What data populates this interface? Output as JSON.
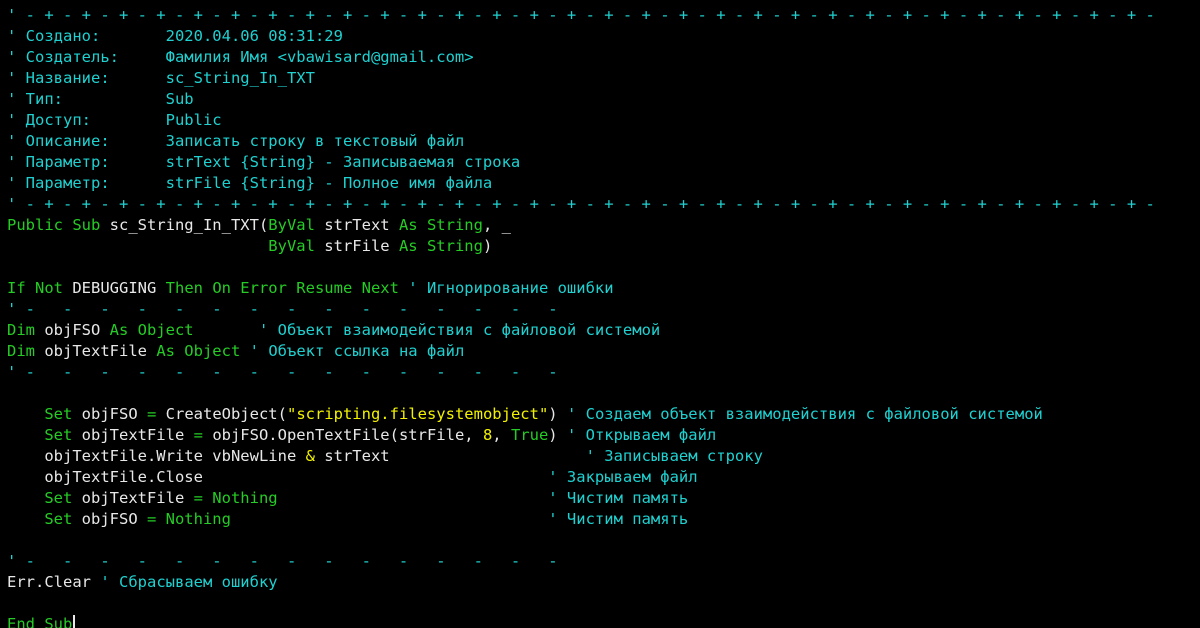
{
  "colors": {
    "background": "#000000",
    "comment": "#1fd1d1",
    "keyword": "#25cc25",
    "text": "#e8e8e8",
    "string": "#f2f200"
  },
  "lines": [
    [
      {
        "t": "' - + - + - + - + - + - + - + - + - + - + - + - + - + - + - + - + - + - + - + - + - + - + - + - + - + - + - + - + - + - + -",
        "c": "c"
      }
    ],
    [
      {
        "t": "' Создано:       2020.04.06 08:31:29",
        "c": "c"
      }
    ],
    [
      {
        "t": "' Создатель:     Фамилия Имя <vbawisard@gmail.com>",
        "c": "c"
      }
    ],
    [
      {
        "t": "' Название:      sc_String_In_TXT",
        "c": "c"
      }
    ],
    [
      {
        "t": "' Тип:           Sub",
        "c": "c"
      }
    ],
    [
      {
        "t": "' Доступ:        Public",
        "c": "c"
      }
    ],
    [
      {
        "t": "' Описание:      Записать строку в текстовый файл",
        "c": "c"
      }
    ],
    [
      {
        "t": "' Параметр:      strText {String} - Записываемая строка",
        "c": "c"
      }
    ],
    [
      {
        "t": "' Параметр:      strFile {String} - Полное имя файла",
        "c": "c"
      }
    ],
    [
      {
        "t": "' - + - + - + - + - + - + - + - + - + - + - + - + - + - + - + - + - + - + - + - + - + - + - + - + - + - + - + - + - + - + -",
        "c": "c"
      }
    ],
    [
      {
        "t": "Public Sub ",
        "c": "k"
      },
      {
        "t": "sc_String_In_TXT(",
        "c": "t"
      },
      {
        "t": "ByVal ",
        "c": "k"
      },
      {
        "t": "strText ",
        "c": "t"
      },
      {
        "t": "As String",
        "c": "k"
      },
      {
        "t": ", _",
        "c": "t"
      }
    ],
    [
      {
        "t": "                            ",
        "c": "t"
      },
      {
        "t": "ByVal ",
        "c": "k"
      },
      {
        "t": "strFile ",
        "c": "t"
      },
      {
        "t": "As String",
        "c": "k"
      },
      {
        "t": ")",
        "c": "t"
      }
    ],
    [],
    [
      {
        "t": "If Not ",
        "c": "k"
      },
      {
        "t": "DEBUGGING ",
        "c": "t"
      },
      {
        "t": "Then On Error Resume Next ",
        "c": "k"
      },
      {
        "t": "' Игнорирование ошибки",
        "c": "c"
      }
    ],
    [
      {
        "t": "' -   -   -   -   -   -   -   -   -   -   -   -   -   -   -",
        "c": "c"
      }
    ],
    [
      {
        "t": "Dim ",
        "c": "k"
      },
      {
        "t": "objFSO ",
        "c": "t"
      },
      {
        "t": "As Object",
        "c": "k"
      },
      {
        "t": "       ",
        "c": "t"
      },
      {
        "t": "' Объект взаимодействия с файловой системой",
        "c": "c"
      }
    ],
    [
      {
        "t": "Dim ",
        "c": "k"
      },
      {
        "t": "objTextFile ",
        "c": "t"
      },
      {
        "t": "As Object",
        "c": "k"
      },
      {
        "t": " ",
        "c": "t"
      },
      {
        "t": "' Объект ссылка на файл",
        "c": "c"
      }
    ],
    [
      {
        "t": "' -   -   -   -   -   -   -   -   -   -   -   -   -   -   -",
        "c": "c"
      }
    ],
    [],
    [
      {
        "t": "    ",
        "c": "t"
      },
      {
        "t": "Set ",
        "c": "k"
      },
      {
        "t": "objFSO ",
        "c": "t"
      },
      {
        "t": "= ",
        "c": "k"
      },
      {
        "t": "CreateObject(",
        "c": "t"
      },
      {
        "t": "\"scripting.filesystemobject\"",
        "c": "s"
      },
      {
        "t": ") ",
        "c": "t"
      },
      {
        "t": "' Создаем объект взаимодействия с файловой системой",
        "c": "c"
      }
    ],
    [
      {
        "t": "    ",
        "c": "t"
      },
      {
        "t": "Set ",
        "c": "k"
      },
      {
        "t": "objTextFile ",
        "c": "t"
      },
      {
        "t": "= ",
        "c": "k"
      },
      {
        "t": "objFSO.OpenTextFile(strFile, ",
        "c": "t"
      },
      {
        "t": "8",
        "c": "s"
      },
      {
        "t": ", ",
        "c": "t"
      },
      {
        "t": "True",
        "c": "k"
      },
      {
        "t": ") ",
        "c": "t"
      },
      {
        "t": "' Открываем файл",
        "c": "c"
      }
    ],
    [
      {
        "t": "    objTextFile.Write vbNewLine ",
        "c": "t"
      },
      {
        "t": "& ",
        "c": "s"
      },
      {
        "t": "strText                     ",
        "c": "t"
      },
      {
        "t": "' Записываем строку",
        "c": "c"
      }
    ],
    [
      {
        "t": "    objTextFile.Close                                     ",
        "c": "t"
      },
      {
        "t": "' Закрываем файл",
        "c": "c"
      }
    ],
    [
      {
        "t": "    ",
        "c": "t"
      },
      {
        "t": "Set ",
        "c": "k"
      },
      {
        "t": "objTextFile ",
        "c": "t"
      },
      {
        "t": "= Nothing",
        "c": "k"
      },
      {
        "t": "                             ",
        "c": "t"
      },
      {
        "t": "' Чистим память",
        "c": "c"
      }
    ],
    [
      {
        "t": "    ",
        "c": "t"
      },
      {
        "t": "Set ",
        "c": "k"
      },
      {
        "t": "objFSO ",
        "c": "t"
      },
      {
        "t": "= Nothing",
        "c": "k"
      },
      {
        "t": "                                  ",
        "c": "t"
      },
      {
        "t": "' Чистим память",
        "c": "c"
      }
    ],
    [],
    [
      {
        "t": "' -   -   -   -   -   -   -   -   -   -   -   -   -   -   -",
        "c": "c"
      }
    ],
    [
      {
        "t": "Err.Clear ",
        "c": "t"
      },
      {
        "t": "' Сбрасываем ошибку",
        "c": "c"
      }
    ],
    [],
    [
      {
        "t": "End Sub",
        "c": "k"
      }
    ]
  ]
}
